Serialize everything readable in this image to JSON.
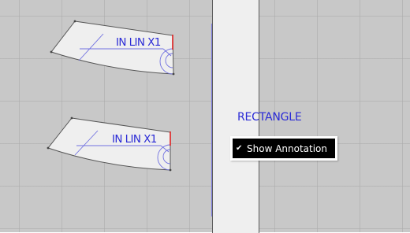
{
  "pieces": [
    {
      "label": "IN LIN X1"
    },
    {
      "label": "IN LIN X1"
    }
  ],
  "rectangle": {
    "label": "RECTANGLE"
  },
  "context_menu": {
    "items": [
      {
        "label": "Show Annotation",
        "checked": true,
        "check_icon": "checkmark-icon"
      }
    ]
  },
  "colors": {
    "canvas": "#c8c8c8",
    "piece_fill": "#efefef",
    "label": "#2a2ad6",
    "seam_guides": "#7070e0",
    "red_marker": "#e02020",
    "menu_highlight": "#000000"
  }
}
